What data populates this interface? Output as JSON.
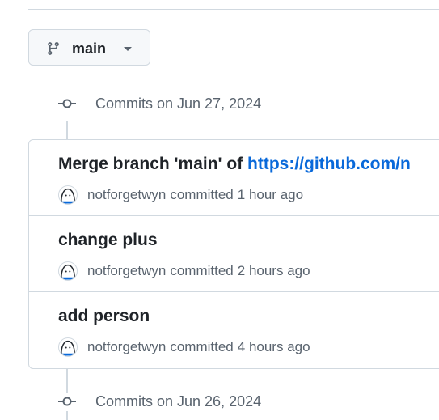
{
  "branch": {
    "name": "main",
    "icon": "git-branch-icon"
  },
  "groups": [
    {
      "label": "Commits on Jun 27, 2024",
      "commits": [
        {
          "title": "Merge branch 'main' of ",
          "link": "https://github.com/n",
          "author": "notforgetwyn",
          "verb": "committed",
          "time": "1 hour ago"
        },
        {
          "title": "change plus",
          "author": "notforgetwyn",
          "verb": "committed",
          "time": "2 hours ago"
        },
        {
          "title": "add person",
          "author": "notforgetwyn",
          "verb": "committed",
          "time": "4 hours ago"
        }
      ]
    },
    {
      "label": "Commits on Jun 26, 2024"
    }
  ],
  "colors": {
    "link": "#0969da",
    "muted": "#59636e",
    "border": "#d1d9e0"
  }
}
